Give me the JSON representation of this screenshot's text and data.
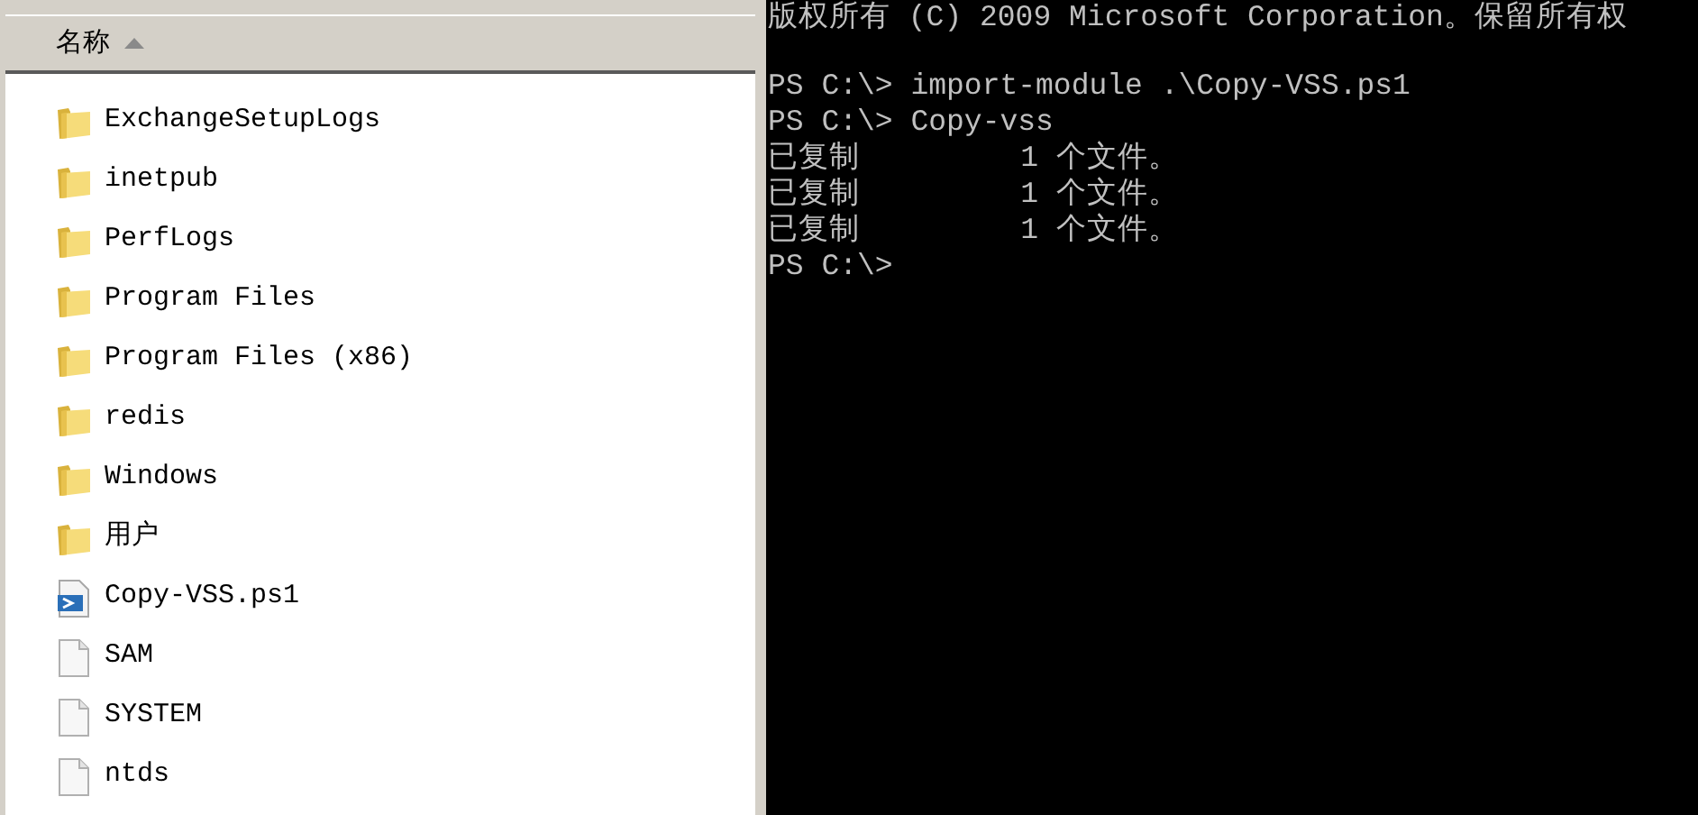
{
  "explorer": {
    "column_header": {
      "label": "名称",
      "sorted": true
    },
    "items": [
      {
        "name": "ExchangeSetupLogs",
        "kind": "folder"
      },
      {
        "name": "inetpub",
        "kind": "folder"
      },
      {
        "name": "PerfLogs",
        "kind": "folder"
      },
      {
        "name": "Program Files",
        "kind": "folder"
      },
      {
        "name": "Program Files (x86)",
        "kind": "folder"
      },
      {
        "name": "redis",
        "kind": "folder"
      },
      {
        "name": "Windows",
        "kind": "folder"
      },
      {
        "name": "用户",
        "kind": "folder"
      },
      {
        "name": "Copy-VSS.ps1",
        "kind": "script"
      },
      {
        "name": "SAM",
        "kind": "file"
      },
      {
        "name": "SYSTEM",
        "kind": "file"
      },
      {
        "name": "ntds",
        "kind": "file"
      }
    ]
  },
  "console": {
    "banner": "版权所有 (C) 2009 Microsoft Corporation。保留所有权",
    "lines": [
      "PS C:\\> import-module .\\Copy-VSS.ps1",
      "PS C:\\> Copy-vss",
      "已复制         1 个文件。",
      "已复制         1 个文件。",
      "已复制         1 个文件。",
      "PS C:\\>"
    ]
  }
}
